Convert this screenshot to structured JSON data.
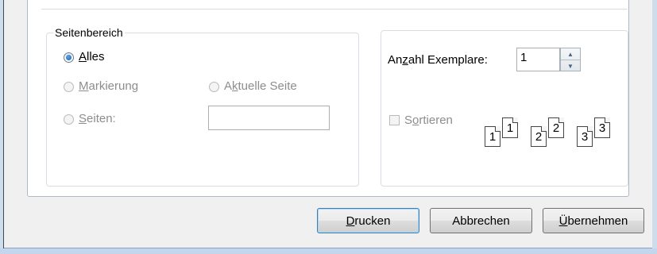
{
  "page_range": {
    "title": "Seitenbereich",
    "all": {
      "pre": "",
      "key": "A",
      "post": "lles",
      "checked": true
    },
    "selection": {
      "pre": "",
      "key": "M",
      "post": "arkierung",
      "disabled": true
    },
    "current_page": {
      "pre": "A",
      "key": "k",
      "post": "tuelle Seite",
      "disabled": true
    },
    "pages": {
      "pre": "",
      "key": "S",
      "post": "eiten:",
      "disabled": true
    },
    "pages_value": ""
  },
  "copies": {
    "label_pre": "An",
    "label_key": "z",
    "label_post": "ahl Exemplare:",
    "value": "1",
    "collate": {
      "pre": "S",
      "key": "o",
      "post": "rtieren",
      "disabled": true
    },
    "collate_pages": [
      {
        "back": "1",
        "front": "1"
      },
      {
        "back": "2",
        "front": "2"
      },
      {
        "back": "3",
        "front": "3"
      }
    ]
  },
  "buttons": {
    "print": {
      "pre": "",
      "key": "D",
      "post": "rucken"
    },
    "cancel": {
      "pre": "",
      "key": "",
      "post": "Abbrechen"
    },
    "apply": {
      "pre": "",
      "key": "Ü",
      "post": "bernehmen"
    }
  }
}
